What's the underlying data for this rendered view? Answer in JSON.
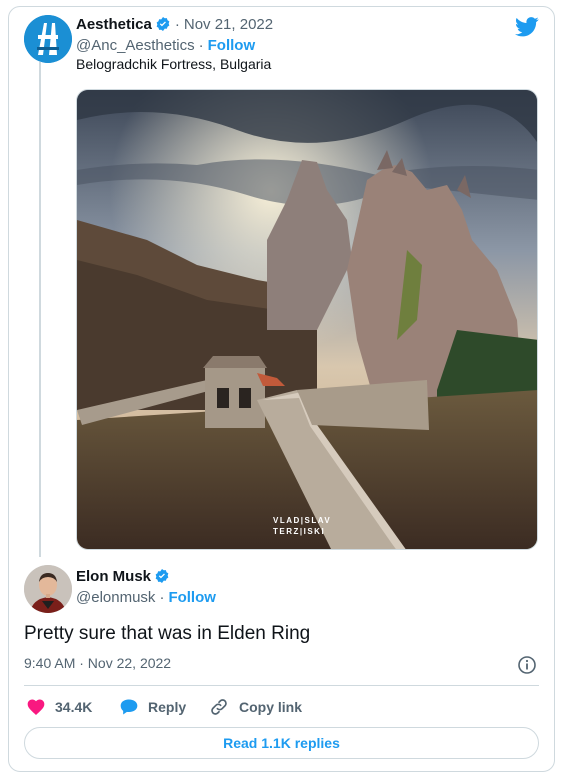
{
  "quoted_tweet": {
    "author_name": "Aesthetica",
    "date": "Nov 21, 2022",
    "handle": "@Anc_Aesthetics",
    "follow_label": "Follow",
    "text": "Belogradchik Fortress, Bulgaria",
    "photo_credit_line1": "VLAD|SLAV",
    "photo_credit_line2": "TERZ|ISKI"
  },
  "reply_tweet": {
    "author_name": "Elon Musk",
    "handle": "@elonmusk",
    "follow_label": "Follow",
    "text": "Pretty sure that was in Elden Ring",
    "timestamp": "9:40 AM · Nov 22, 2022"
  },
  "actions": {
    "like_count": "34.4K",
    "reply_label": "Reply",
    "copy_link_label": "Copy link"
  },
  "read_replies_label": "Read 1.1K replies",
  "icons": {
    "verified": "verified-badge-icon",
    "twitter": "twitter-bird-icon",
    "info": "info-icon",
    "like": "heart-icon",
    "reply": "reply-bubble-icon",
    "link": "link-icon"
  },
  "colors": {
    "accent": "#1d9bf0",
    "like": "#f91880",
    "muted": "#536471",
    "border": "#cfd9de"
  }
}
